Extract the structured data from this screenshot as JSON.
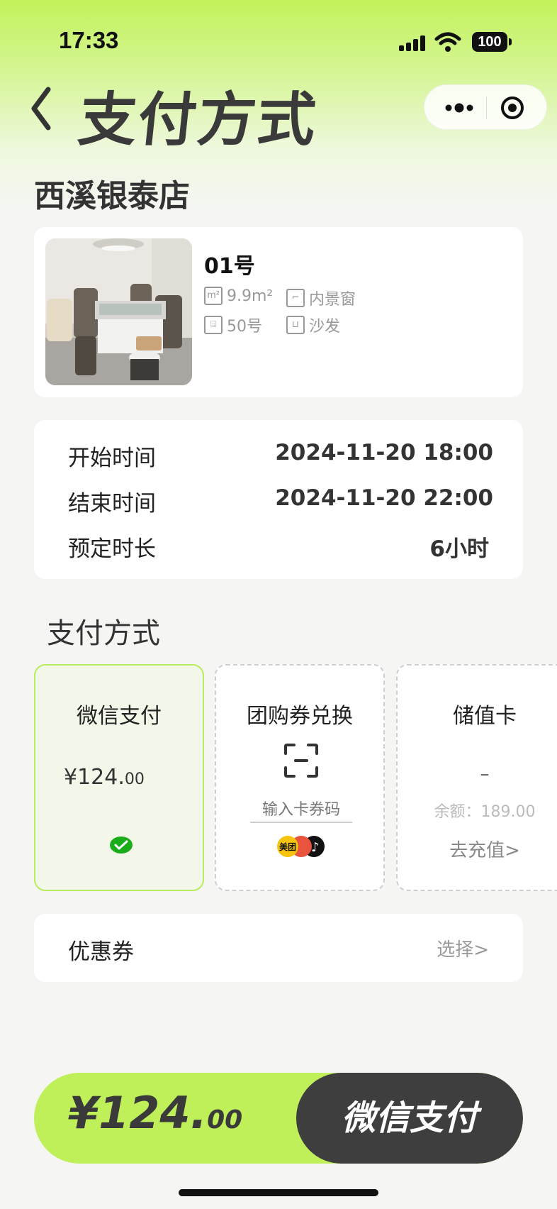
{
  "status_bar": {
    "time": "17:33",
    "battery": "100"
  },
  "header": {
    "title": "支付方式"
  },
  "store": {
    "name": "西溪银泰店"
  },
  "room": {
    "name": "01号",
    "features": [
      {
        "icon": "area-icon",
        "text": "9.9m²"
      },
      {
        "icon": "window-icon",
        "text": "内景窗"
      },
      {
        "icon": "table-icon",
        "text": "50号"
      },
      {
        "icon": "sofa-icon",
        "text": "沙发"
      }
    ]
  },
  "booking": {
    "start_label": "开始时间",
    "start_value": "2024-11-20 18:00",
    "end_label": "结束时间",
    "end_value": "2024-11-20 22:00",
    "duration_label": "预定时长",
    "duration_value": "6小时"
  },
  "payment": {
    "section_title": "支付方式",
    "wechat": {
      "title": "微信支付",
      "amount_main": "¥124.",
      "amount_decimal": "00"
    },
    "group": {
      "title": "团购券兑换",
      "placeholder": "输入卡券码",
      "logo_text": "美团"
    },
    "stored": {
      "title": "储值卡",
      "value": "–",
      "balance": "余额：189.00",
      "recharge": "去充值>"
    }
  },
  "coupon": {
    "label": "优惠券",
    "action": "选择>"
  },
  "footer": {
    "total_main": "¥124.",
    "total_decimal": "00",
    "pay_label": "微信支付"
  },
  "colors": {
    "accent": "#bff05a",
    "dark": "#3e3e3e",
    "wechat_green": "#1aad19"
  }
}
